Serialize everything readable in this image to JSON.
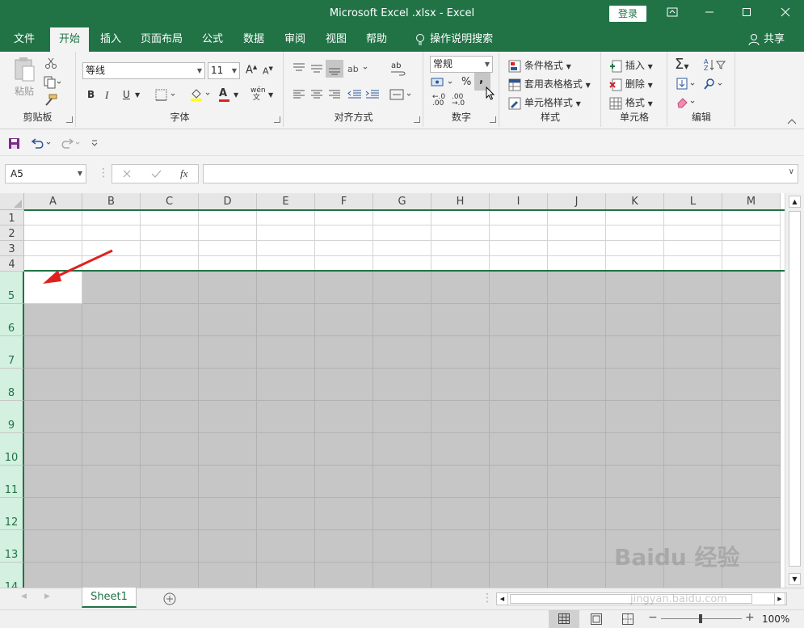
{
  "window": {
    "title": "Microsoft Excel .xlsx  -  Excel",
    "login_label": "登录",
    "controls": [
      "ribbon-display-icon",
      "minimize-icon",
      "maximize-icon",
      "close-icon"
    ]
  },
  "menu": {
    "tabs": [
      "文件",
      "开始",
      "插入",
      "页面布局",
      "公式",
      "数据",
      "审阅",
      "视图",
      "帮助"
    ],
    "active_tab": "开始",
    "tell_me": "操作说明搜索",
    "share": "共享"
  },
  "ribbon": {
    "clipboard": {
      "paste": "粘贴",
      "label": "剪贴板"
    },
    "font": {
      "name": "等线",
      "size": "11",
      "label": "字体",
      "bold": "B",
      "italic": "I",
      "underline": "U",
      "phonetic": "wén"
    },
    "alignment": {
      "label": "对齐方式"
    },
    "number": {
      "format": "常规",
      "percent": "%",
      "comma": ",",
      "label": "数字"
    },
    "styles": {
      "conditional": "条件格式",
      "table": "套用表格格式",
      "cell_styles": "单元格样式",
      "label": "样式"
    },
    "cells": {
      "insert": "插入",
      "delete": "删除",
      "format": "格式",
      "label": "单元格"
    },
    "editing": {
      "label": "编辑"
    }
  },
  "formula_bar": {
    "name_box": "A5",
    "fx": "fx",
    "value": ""
  },
  "grid": {
    "columns": [
      "A",
      "B",
      "C",
      "D",
      "E",
      "F",
      "G",
      "H",
      "I",
      "J",
      "K",
      "L",
      "M"
    ],
    "rows": [
      "1",
      "2",
      "3",
      "4",
      "5",
      "6",
      "7",
      "8",
      "9",
      "10",
      "11",
      "12",
      "13",
      "14"
    ],
    "active_cell": "A5",
    "selected_rows": "5-14"
  },
  "sheets": {
    "tabs": [
      "Sheet1"
    ]
  },
  "status": {
    "zoom": "100%"
  },
  "colors": {
    "accent": "#217346",
    "selection": "#c6c6c6",
    "arrow": "#e02020"
  },
  "watermark": {
    "brand": "Baidu 经验",
    "url": "jingyan.baidu.com"
  }
}
